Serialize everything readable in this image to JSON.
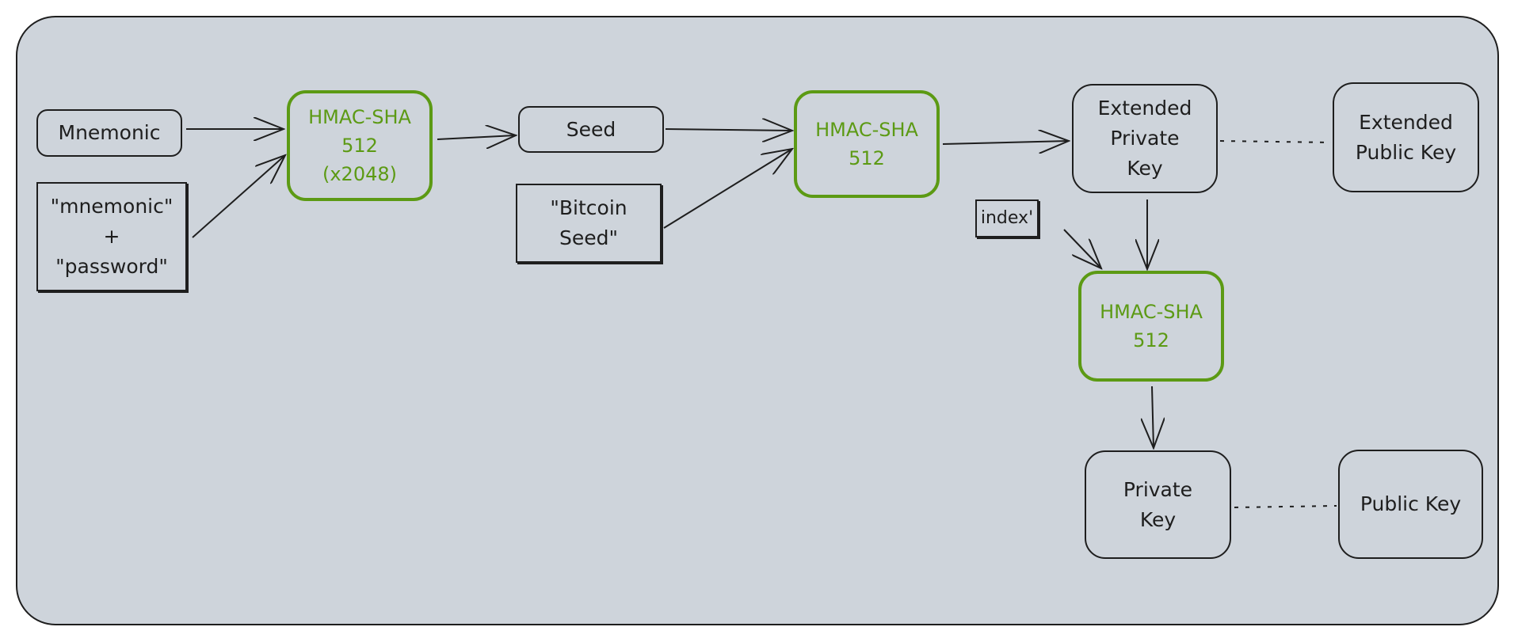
{
  "colors": {
    "background": "#ced4db",
    "stroke": "#1e1e1e",
    "accent": "#5c9a14"
  },
  "nodes": {
    "mnemonic": {
      "lines": [
        "Mnemonic"
      ]
    },
    "salt": {
      "lines": [
        "\"mnemonic\"",
        "+",
        "\"password\""
      ]
    },
    "hmac1": {
      "lines": [
        "HMAC-SHA",
        "512",
        "(x2048)"
      ]
    },
    "seed": {
      "lines": [
        "Seed"
      ]
    },
    "bitcoin_seed": {
      "lines": [
        "\"Bitcoin",
        "Seed\""
      ]
    },
    "hmac2": {
      "lines": [
        "HMAC-SHA",
        "512"
      ]
    },
    "ext_priv": {
      "lines": [
        "Extended",
        "Private",
        "Key"
      ]
    },
    "ext_pub": {
      "lines": [
        "Extended",
        "Public Key"
      ]
    },
    "index": {
      "lines": [
        "index'"
      ]
    },
    "hmac3": {
      "lines": [
        "HMAC-SHA",
        "512"
      ]
    },
    "priv": {
      "lines": [
        "Private",
        "Key"
      ]
    },
    "pub": {
      "lines": [
        "Public Key"
      ]
    }
  },
  "edges": [
    {
      "from": "mnemonic",
      "to": "hmac1",
      "style": "arrow"
    },
    {
      "from": "salt",
      "to": "hmac1",
      "style": "arrow"
    },
    {
      "from": "hmac1",
      "to": "seed",
      "style": "arrow"
    },
    {
      "from": "seed",
      "to": "hmac2",
      "style": "arrow"
    },
    {
      "from": "bitcoin_seed",
      "to": "hmac2",
      "style": "arrow"
    },
    {
      "from": "hmac2",
      "to": "ext_priv",
      "style": "arrow"
    },
    {
      "from": "ext_priv",
      "to": "hmac3",
      "style": "arrow"
    },
    {
      "from": "index",
      "to": "hmac3",
      "style": "arrow"
    },
    {
      "from": "hmac3",
      "to": "priv",
      "style": "arrow"
    },
    {
      "from": "ext_priv",
      "to": "ext_pub",
      "style": "dotted"
    },
    {
      "from": "priv",
      "to": "pub",
      "style": "dotted"
    }
  ]
}
